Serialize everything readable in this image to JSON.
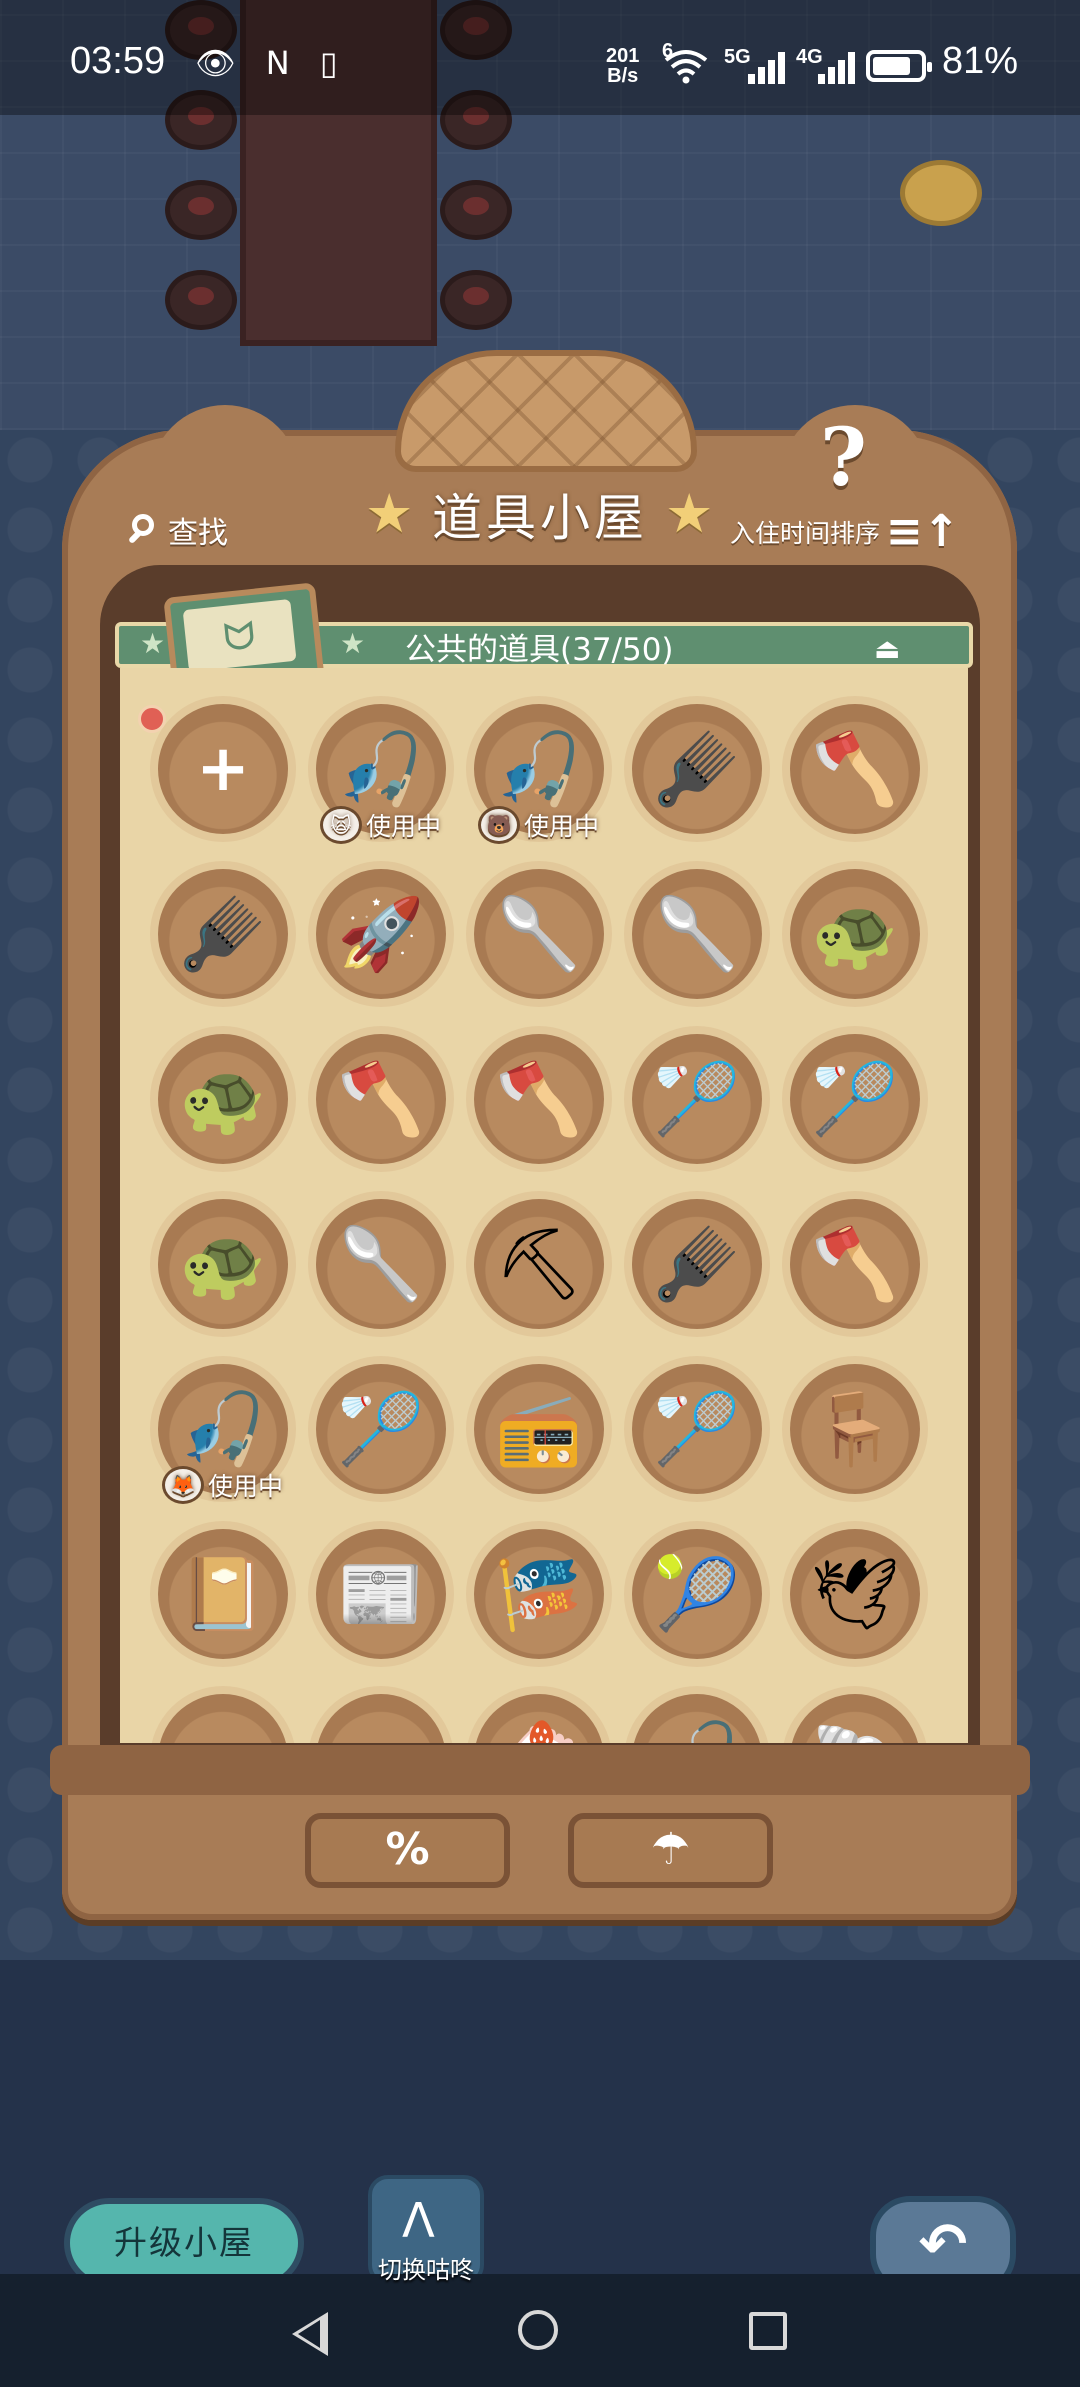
{
  "status_bar": {
    "time": "03:59",
    "net_speed_value": "201",
    "net_speed_unit": "B/s",
    "wifi_label": "6",
    "sim1_label": "5G",
    "sim2_label": "4G",
    "battery_percent": "81%",
    "battery_level": 0.81
  },
  "panel": {
    "title": "道具小屋",
    "search_label": "查找",
    "sort_label": "入住时间排序",
    "sort_icon": "≡↑",
    "help_icon": "?",
    "section": {
      "title": "公共的道具(37/50)",
      "toggle_icon": "⏏"
    }
  },
  "grid": {
    "add_slot_icon": "+",
    "rows": [
      [
        {
          "icon": "add",
          "glyph": "+"
        },
        {
          "icon": "fishing-rod",
          "glyph": "🎣",
          "in_use": "使用中",
          "user_face": "🙀"
        },
        {
          "icon": "fishing-rod",
          "glyph": "🎣",
          "in_use": "使用中",
          "user_face": "🐻"
        },
        {
          "icon": "rake",
          "glyph": "🪮"
        },
        {
          "icon": "axe",
          "glyph": "🪓"
        }
      ],
      [
        {
          "icon": "rake",
          "glyph": "🪮"
        },
        {
          "icon": "rocket",
          "glyph": "🚀"
        },
        {
          "icon": "shovel",
          "glyph": "🥄"
        },
        {
          "icon": "shovel",
          "glyph": "🥄"
        },
        {
          "icon": "turtle-timer",
          "glyph": "🐢"
        }
      ],
      [
        {
          "icon": "turtle-timer",
          "glyph": "🐢"
        },
        {
          "icon": "axe",
          "glyph": "🪓"
        },
        {
          "icon": "axe",
          "glyph": "🪓"
        },
        {
          "icon": "bug-net",
          "glyph": "🏸"
        },
        {
          "icon": "bug-net",
          "glyph": "🏸"
        }
      ],
      [
        {
          "icon": "turtle-timer",
          "glyph": "🐢"
        },
        {
          "icon": "shovel",
          "glyph": "🥄"
        },
        {
          "icon": "pickaxe",
          "glyph": "⛏"
        },
        {
          "icon": "rake",
          "glyph": "🪮"
        },
        {
          "icon": "axe",
          "glyph": "🪓"
        }
      ],
      [
        {
          "icon": "fishing-rod",
          "glyph": "🎣",
          "in_use": "使用中",
          "user_face": "🦊"
        },
        {
          "icon": "bug-net",
          "glyph": "🏸"
        },
        {
          "icon": "music-player",
          "glyph": "📻"
        },
        {
          "icon": "bug-net",
          "glyph": "🏸"
        },
        {
          "icon": "toy-chair",
          "glyph": "🪑"
        }
      ],
      [
        {
          "icon": "picture-book",
          "glyph": "📔"
        },
        {
          "icon": "magazine",
          "glyph": "📰"
        },
        {
          "icon": "streamer-flags",
          "glyph": "🎏"
        },
        {
          "icon": "tennis-racket",
          "glyph": "🎾"
        },
        {
          "icon": "paper-crane",
          "glyph": "🕊"
        }
      ],
      [
        {
          "icon": "cotton-candy",
          "glyph": "☁"
        },
        {
          "icon": "cotton-candy",
          "glyph": "☁"
        },
        {
          "icon": "cake",
          "glyph": "🍰"
        },
        {
          "icon": "fishing-rod",
          "glyph": "🎣"
        },
        {
          "icon": "shell",
          "glyph": "🐚"
        }
      ]
    ]
  },
  "actions": {
    "discount_icon": "%",
    "umbrella_icon": "☂"
  },
  "footer": {
    "upgrade_label": "升级小屋",
    "switch_label": "切换咕咚",
    "switch_icon": "ᐱ",
    "back_icon": "↶"
  },
  "nav": {
    "back": "back-triangle",
    "home": "home-circle",
    "recent": "recent-square"
  }
}
